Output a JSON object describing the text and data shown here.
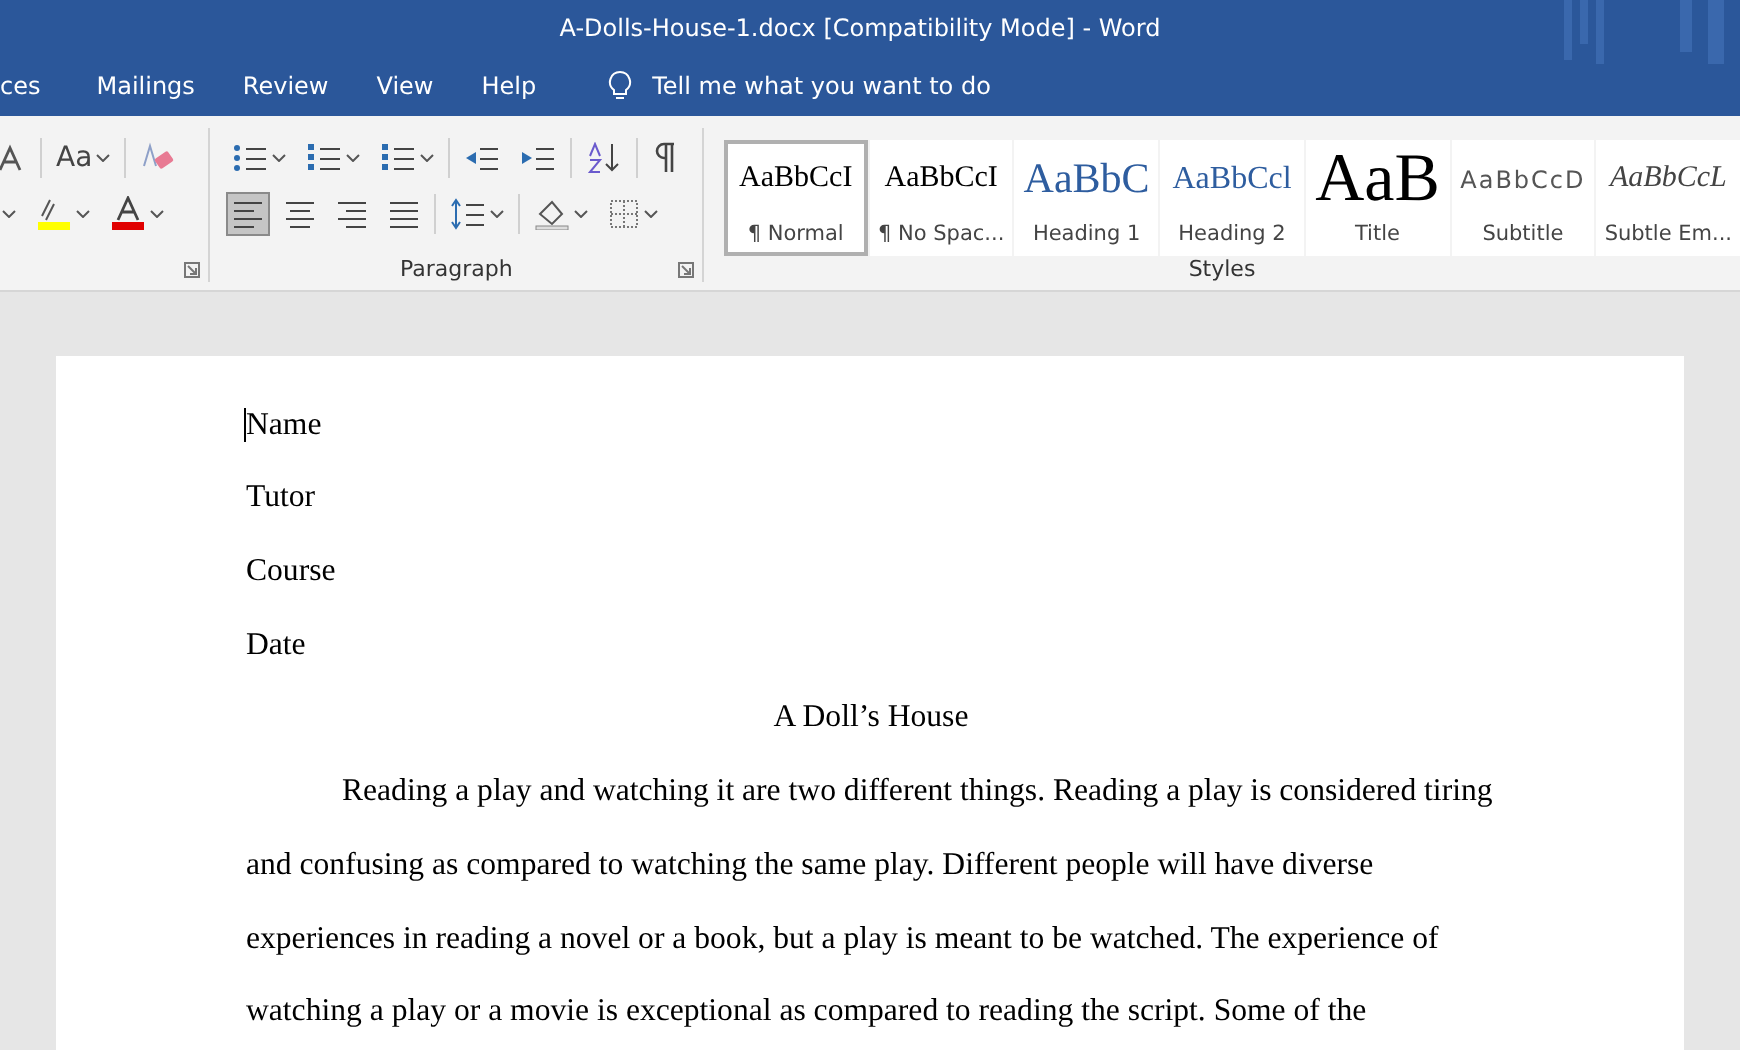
{
  "window": {
    "title": "A-Dolls-House-1.docx [Compatibility Mode]  -  Word"
  },
  "menu": {
    "items": [
      "ces",
      "Mailings",
      "Review",
      "View",
      "Help"
    ],
    "tell_me": "Tell me what you want to do"
  },
  "ribbon": {
    "font_group": {
      "case_label": "Aa"
    },
    "paragraph_group": {
      "label": "Paragraph",
      "alignment": [
        {
          "kind": "left",
          "selected": true
        },
        {
          "kind": "center",
          "selected": false
        },
        {
          "kind": "right",
          "selected": false
        },
        {
          "kind": "justify",
          "selected": false
        }
      ]
    },
    "styles_group": {
      "label": "Styles",
      "styles": [
        {
          "preview": "AaBbCcI",
          "name": "¶ Normal",
          "kind": "normal",
          "selected": true
        },
        {
          "preview": "AaBbCcI",
          "name": "¶ No Spac...",
          "kind": "normal",
          "selected": false
        },
        {
          "preview": "AaBbC",
          "name": "Heading 1",
          "kind": "heading1",
          "selected": false
        },
        {
          "preview": "AaBbCcl",
          "name": "Heading 2",
          "kind": "heading2",
          "selected": false
        },
        {
          "preview": "AaB",
          "name": "Title",
          "kind": "title",
          "selected": false
        },
        {
          "preview": "AaBbCcD",
          "name": "Subtitle",
          "kind": "subtitle",
          "selected": false
        },
        {
          "preview": "AaBbCcL",
          "name": "Subtle Em...",
          "kind": "emphasis",
          "selected": false
        }
      ]
    }
  },
  "document": {
    "lines": [
      "Name",
      "Tutor",
      "Course",
      "Date"
    ],
    "title": "A Doll’s House",
    "paragraph": "Reading a play and watching it are two different things. Reading a play is considered tiring and confusing as compared to watching the same play. Different people will have diverse experiences in reading a novel or a book, but a play is meant to be watched. The experience of watching a play or a movie is exceptional as compared to reading the script. Some of the"
  }
}
